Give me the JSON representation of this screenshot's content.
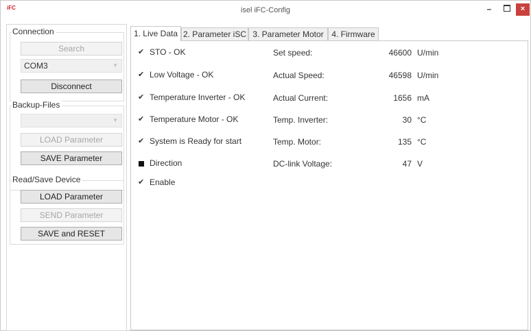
{
  "window": {
    "title": "isel iFC-Config",
    "logo_text": "iFC",
    "minimize": "–",
    "close": "×"
  },
  "connection": {
    "title": "Connection",
    "search_label": "Search",
    "port_value": "COM3",
    "disconnect_label": "Disconnect"
  },
  "backup": {
    "title": "Backup-Files",
    "file_value": "",
    "load_label": "LOAD Parameter",
    "save_label": "SAVE Parameter"
  },
  "device": {
    "title": "Read/Save Device",
    "load_label": "LOAD Parameter",
    "send_label": "SEND Parameter",
    "save_reset_label": "SAVE and RESET"
  },
  "tabs": [
    {
      "label": "1. Live Data",
      "active": true
    },
    {
      "label": "2. Parameter iSC",
      "active": false
    },
    {
      "label": "3. Parameter Motor",
      "active": false
    },
    {
      "label": "4. Firmware",
      "active": false
    }
  ],
  "live": {
    "status": [
      {
        "label": "STO - OK",
        "icon": "check",
        "checked": true
      },
      {
        "label": "Low Voltage - OK",
        "icon": "check",
        "checked": true
      },
      {
        "label": "Temperature Inverter - OK",
        "icon": "check",
        "checked": true
      },
      {
        "label": "Temperature Motor - OK",
        "icon": "check",
        "checked": true
      },
      {
        "label": "System is Ready for start",
        "icon": "check",
        "checked": true
      },
      {
        "label": "Direction",
        "icon": "square",
        "checked": false
      },
      {
        "label": "Enable",
        "icon": "check",
        "checked": true
      }
    ],
    "values": [
      {
        "label": "Set speed:",
        "value": "46600",
        "unit": "U/min"
      },
      {
        "label": "Actual Speed:",
        "value": "46598",
        "unit": "U/min"
      },
      {
        "label": "Actual Current:",
        "value": "1656",
        "unit": "mA"
      },
      {
        "label": "Temp. Inverter:",
        "value": "30",
        "unit": "°C"
      },
      {
        "label": "Temp. Motor:",
        "value": "135",
        "unit": "°C"
      },
      {
        "label": "DC-link Voltage:",
        "value": "47",
        "unit": "V"
      }
    ]
  },
  "icons": {
    "check": "✔",
    "combo_arrow": "▼"
  },
  "colors": {
    "close_button": "#c9413d",
    "logo": "#d4202a"
  }
}
